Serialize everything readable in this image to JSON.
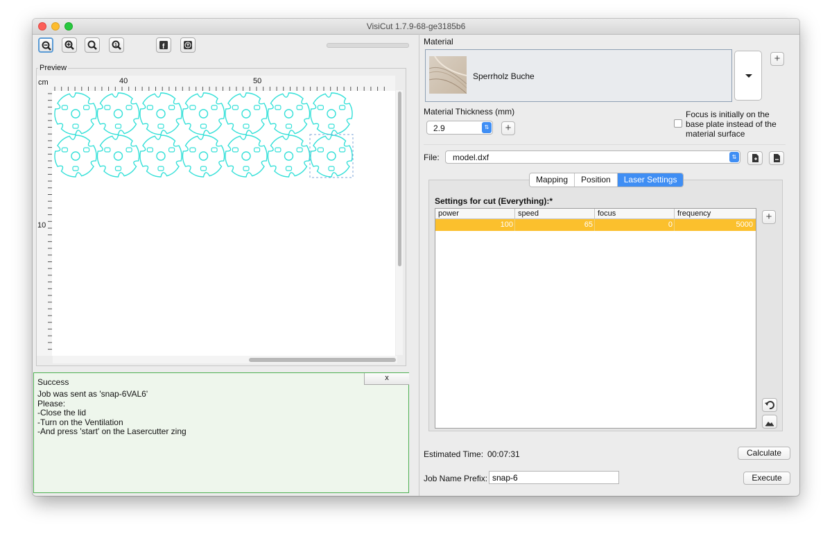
{
  "window": {
    "title": "VisiCut 1.7.9-68-ge3185b6"
  },
  "toolbar": {
    "buttons": [
      {
        "name": "zoom-out-button",
        "icon": "zoom-out-icon",
        "active": true
      },
      {
        "name": "zoom-in-button",
        "icon": "zoom-in-icon",
        "active": false
      },
      {
        "name": "zoom-fit-button",
        "icon": "zoom-fit-icon",
        "active": false
      },
      {
        "name": "zoom-reset-button",
        "icon": "zoom-reset-icon",
        "active": false
      },
      {
        "name": "facebook-button",
        "icon": "facebook-icon",
        "active": false
      },
      {
        "name": "thingiverse-button",
        "icon": "thingiverse-icon",
        "active": false
      }
    ]
  },
  "preview": {
    "label": "Preview",
    "unit": "cm",
    "ruler_x_labels": [
      "40",
      "50"
    ],
    "ruler_y_label": "10",
    "shape_color": "#33e0d8"
  },
  "status": {
    "title": "Success",
    "close_label": "x",
    "lines": [
      "Job was sent as 'snap-6VAL6'",
      "Please:",
      "-Close the lid",
      "-Turn on the Ventilation",
      "-And press 'start' on the Lasercutter zing"
    ]
  },
  "material": {
    "label": "Material",
    "name": "Sperrholz Buche",
    "thickness_label": "Material Thickness (mm)",
    "thickness_value": "2.9",
    "focus_text": [
      "Focus is initially on the",
      "base plate instead of the",
      "material surface"
    ],
    "focus_checked": false
  },
  "file": {
    "label": "File:",
    "value": "model.dxf"
  },
  "tabs": [
    {
      "label": "Mapping",
      "selected": false
    },
    {
      "label": "Position",
      "selected": false
    },
    {
      "label": "Laser Settings",
      "selected": true
    }
  ],
  "settings": {
    "title": "Settings for cut (Everything):*",
    "columns": [
      "power",
      "speed",
      "focus",
      "frequency"
    ],
    "rows": [
      [
        "100",
        "65",
        "0",
        "5000"
      ]
    ],
    "row_color": "#fbc02d"
  },
  "footer": {
    "estimated_label": "Estimated Time:",
    "estimated_value": "00:07:31",
    "calculate_label": "Calculate",
    "job_prefix_label": "Job Name Prefix:",
    "job_prefix_value": "snap-6",
    "execute_label": "Execute"
  },
  "colors": {
    "accent": "#3f8ef4",
    "success_bg": "#eef6ec",
    "success_border": "#4caf50"
  }
}
